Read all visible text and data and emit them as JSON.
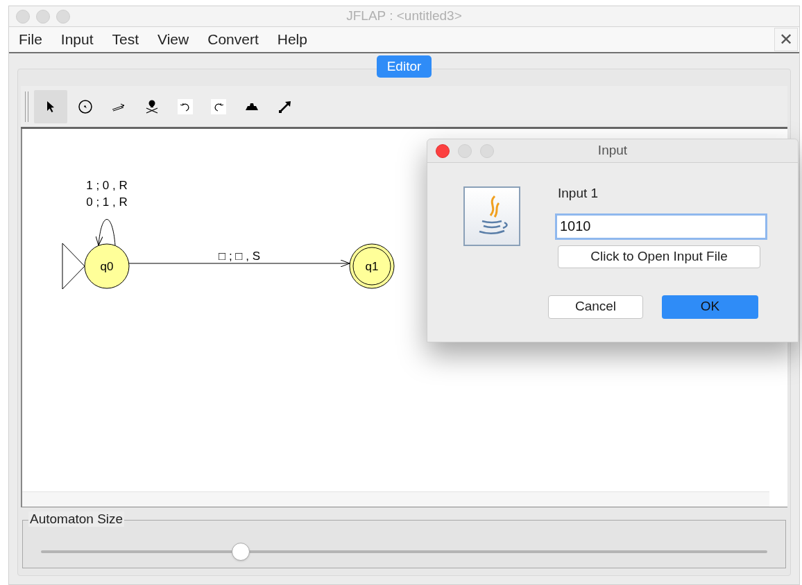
{
  "window": {
    "title": "JFLAP : <untitled3>"
  },
  "menu": [
    "File",
    "Input",
    "Test",
    "View",
    "Convert",
    "Help"
  ],
  "close_label": "✕",
  "tabs": [
    {
      "label": "Editor",
      "selected": true
    }
  ],
  "tools": [
    {
      "kind": "select",
      "selected": true
    },
    {
      "kind": "state",
      "selected": false
    },
    {
      "kind": "transition",
      "selected": false
    },
    {
      "kind": "delete",
      "selected": false
    },
    {
      "kind": "undo",
      "selected": false
    },
    {
      "kind": "redo",
      "selected": false
    },
    {
      "kind": "attribute",
      "selected": false
    },
    {
      "kind": "move",
      "selected": false
    }
  ],
  "states": [
    {
      "name": "q0",
      "initial": true,
      "final": false
    },
    {
      "name": "q1",
      "initial": false,
      "final": true
    }
  ],
  "transitions": [
    {
      "kind": "loop",
      "labels": [
        "1 ; 0 , R",
        "0 ; 1 , R"
      ]
    },
    {
      "kind": "edge",
      "labels": [
        "□ ; □ , S"
      ]
    }
  ],
  "size_panel": {
    "title": "Automaton Size",
    "level": 0.275
  },
  "dialog": {
    "title": "Input",
    "prompt": "Input 1",
    "value": "1010",
    "file_button": "Click to Open Input File",
    "buttons": [
      {
        "label": "Cancel",
        "kind": "default"
      },
      {
        "label": "OK",
        "kind": "primary"
      }
    ]
  }
}
